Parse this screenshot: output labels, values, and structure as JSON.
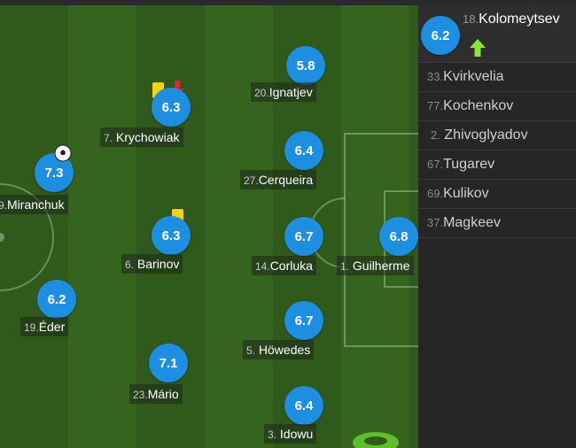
{
  "colors": {
    "rating_bg": "#1e8fe0",
    "pitch_dark": "#2f5a1c",
    "pitch_light": "#35641f",
    "panel_bg": "#262626"
  },
  "players": [
    {
      "id": "ignatjev",
      "number": "20.",
      "name": "Ignatjev",
      "rating": "5.8"
    },
    {
      "id": "krychowiak",
      "number": "7.",
      "name": "Krychowiak",
      "rating": "6.3",
      "icons": [
        "yellow-card-icon",
        "sub-out-arrow-icon"
      ]
    },
    {
      "id": "miranchuk",
      "number": "9.",
      "name": "Miranchuk",
      "rating": "7.3",
      "icons": [
        "goal-ball-icon"
      ]
    },
    {
      "id": "cerqueira",
      "number": "27.",
      "name": "Cerqueira",
      "rating": "6.4"
    },
    {
      "id": "barinov",
      "number": "6.",
      "name": "Barinov",
      "rating": "6.3",
      "icons": [
        "yellow-card-icon"
      ]
    },
    {
      "id": "corluka",
      "number": "14.",
      "name": "Corluka",
      "rating": "6.7"
    },
    {
      "id": "guilherme",
      "number": "1.",
      "name": "Guilherme",
      "rating": "6.8"
    },
    {
      "id": "eder",
      "number": "19.",
      "name": "Éder",
      "rating": "6.2"
    },
    {
      "id": "howedes",
      "number": "5.",
      "name": "Höwedes",
      "rating": "6.7"
    },
    {
      "id": "mario",
      "number": "23.",
      "name": "Mário",
      "rating": "7.1"
    },
    {
      "id": "idowu",
      "number": "3.",
      "name": "Idowu",
      "rating": "6.4"
    }
  ],
  "substitutes": {
    "featured": {
      "number": "18.",
      "name": "Kolomeytsev",
      "rating": "6.2",
      "icon": "sub-in-arrow-icon"
    },
    "list": [
      {
        "number": "33.",
        "name": "Kvirkvelia"
      },
      {
        "number": "77.",
        "name": "Kochenkov"
      },
      {
        "number": "2.",
        "name": "Zhivoglyadov"
      },
      {
        "number": "67.",
        "name": "Tugarev"
      },
      {
        "number": "69.",
        "name": "Kulikov"
      },
      {
        "number": "37.",
        "name": "Magkeev"
      }
    ]
  }
}
